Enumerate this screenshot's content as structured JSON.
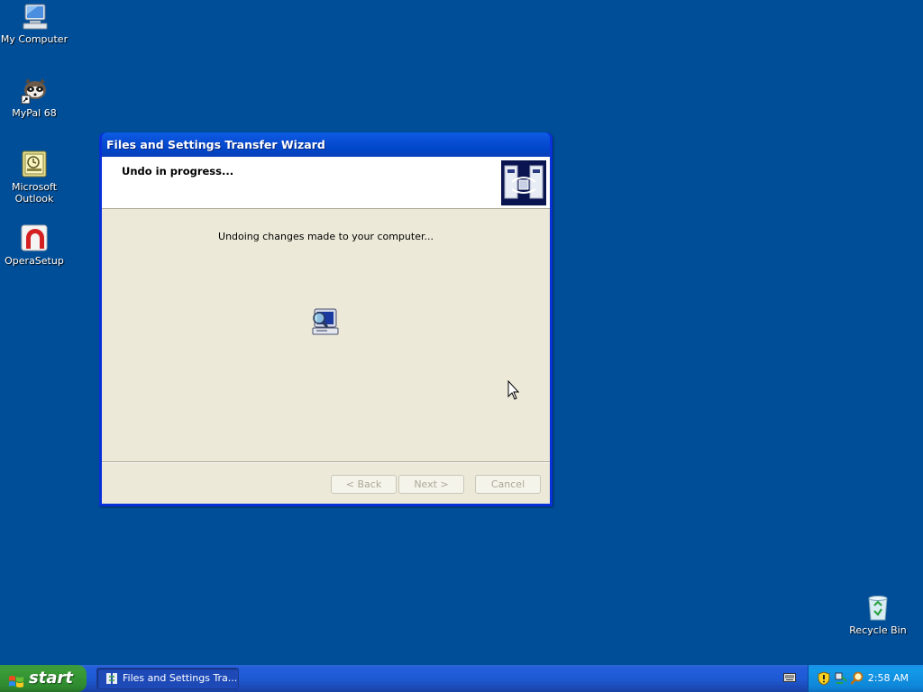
{
  "desktop": {
    "icons": [
      {
        "label": "My Computer"
      },
      {
        "label": "MyPal 68"
      },
      {
        "label": "Microsoft Outlook"
      },
      {
        "label": "OperaSetup"
      },
      {
        "label": "Recycle Bin"
      }
    ]
  },
  "window": {
    "title": "Files and Settings Transfer Wizard",
    "header_title": "Undo in progress...",
    "status_text": "Undoing changes made to your computer...",
    "buttons": {
      "back": "< Back",
      "next": "Next >",
      "cancel": "Cancel"
    }
  },
  "taskbar": {
    "start_label": "start",
    "task_item_label": "Files and Settings Tra...",
    "clock": "2:58 AM"
  },
  "colors": {
    "desktop_bg": "#004e98",
    "title_bar": "#0a50d8",
    "dialog_bg": "#ece9d8",
    "taskbar": "#245edb",
    "start_button": "#3a9c38",
    "tray": "#129ae8"
  }
}
